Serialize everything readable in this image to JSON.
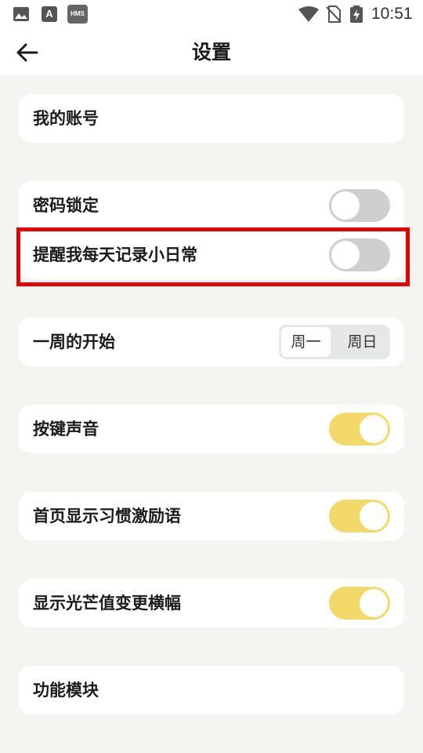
{
  "status_bar": {
    "time": "10:51",
    "hms_label": "HMS",
    "a_label": "A",
    "icons": [
      "image-icon",
      "app-a-icon",
      "hms-icon",
      "wifi-icon",
      "no-sim-icon",
      "battery-charging-icon"
    ]
  },
  "header": {
    "title": "设置",
    "back_icon": "back-arrow-icon"
  },
  "settings": {
    "my_account": {
      "label": "我的账号"
    },
    "password_lock": {
      "label": "密码锁定",
      "enabled": false
    },
    "daily_reminder": {
      "label": "提醒我每天记录小日常",
      "enabled": false,
      "highlighted": true
    },
    "week_start": {
      "label": "一周的开始",
      "options": [
        "周一",
        "周日"
      ],
      "selected": "周一"
    },
    "key_sound": {
      "label": "按键声音",
      "enabled": true
    },
    "home_motivation": {
      "label": "首页显示习惯激励语",
      "enabled": true
    },
    "glow_banner": {
      "label": "显示光芒值变更横幅",
      "enabled": true
    },
    "feature_modules": {
      "label": "功能模块"
    }
  },
  "colors": {
    "background": "#f4f5f0",
    "toggle_on": "#f2d96a",
    "toggle_off": "#cfcfcf",
    "highlight": "#e50000"
  }
}
